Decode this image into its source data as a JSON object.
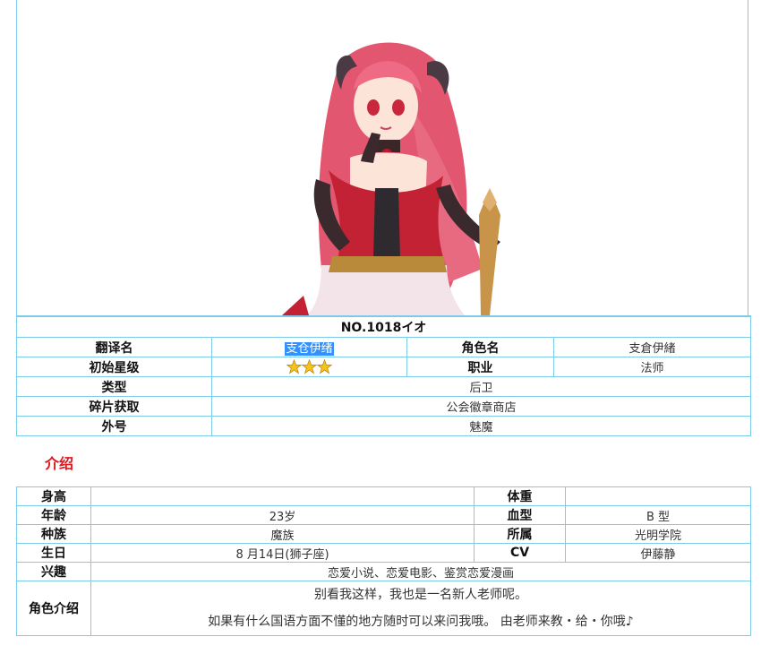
{
  "character": {
    "title": "NO.1018イオ",
    "rows": [
      {
        "label": "翻译名",
        "value": "支仓伊绪",
        "label2": "角色名",
        "value2": "支倉伊緒"
      },
      {
        "label": "初始星级",
        "stars": 3,
        "label2": "职业",
        "value2": "法师"
      },
      {
        "label": "类型",
        "value": "后卫"
      },
      {
        "label": "碎片获取",
        "value": "公会徽章商店"
      },
      {
        "label": "外号",
        "value": "魅魔"
      }
    ]
  },
  "intro": {
    "heading": "介绍"
  },
  "profile": {
    "height_label": "身高",
    "height": "",
    "weight_label": "体重",
    "weight": "",
    "age_label": "年龄",
    "age": "23岁",
    "blood_label": "血型",
    "blood": "B 型",
    "race_label": "种族",
    "race": "魔族",
    "affiliation_label": "所属",
    "affiliation": "光明学院",
    "birthday_label": "生日",
    "birthday": "8 月14日(狮子座)",
    "cv_label": "CV",
    "cv": "伊藤静",
    "hobby_label": "兴趣",
    "hobby": "恋爱小说、恋爱电影、鉴赏恋爱漫画",
    "desc_label": "角色介绍",
    "desc_lines": [
      "别看我这样，我也是一名新人老师呢。",
      "如果有什么国语方面不懂的地方随时可以来问我哦。 由老师来教・给・你哦♪"
    ]
  },
  "colors": {
    "border": "#7ccbe8",
    "heading": "#e3141a",
    "selection": "#3390ff"
  }
}
